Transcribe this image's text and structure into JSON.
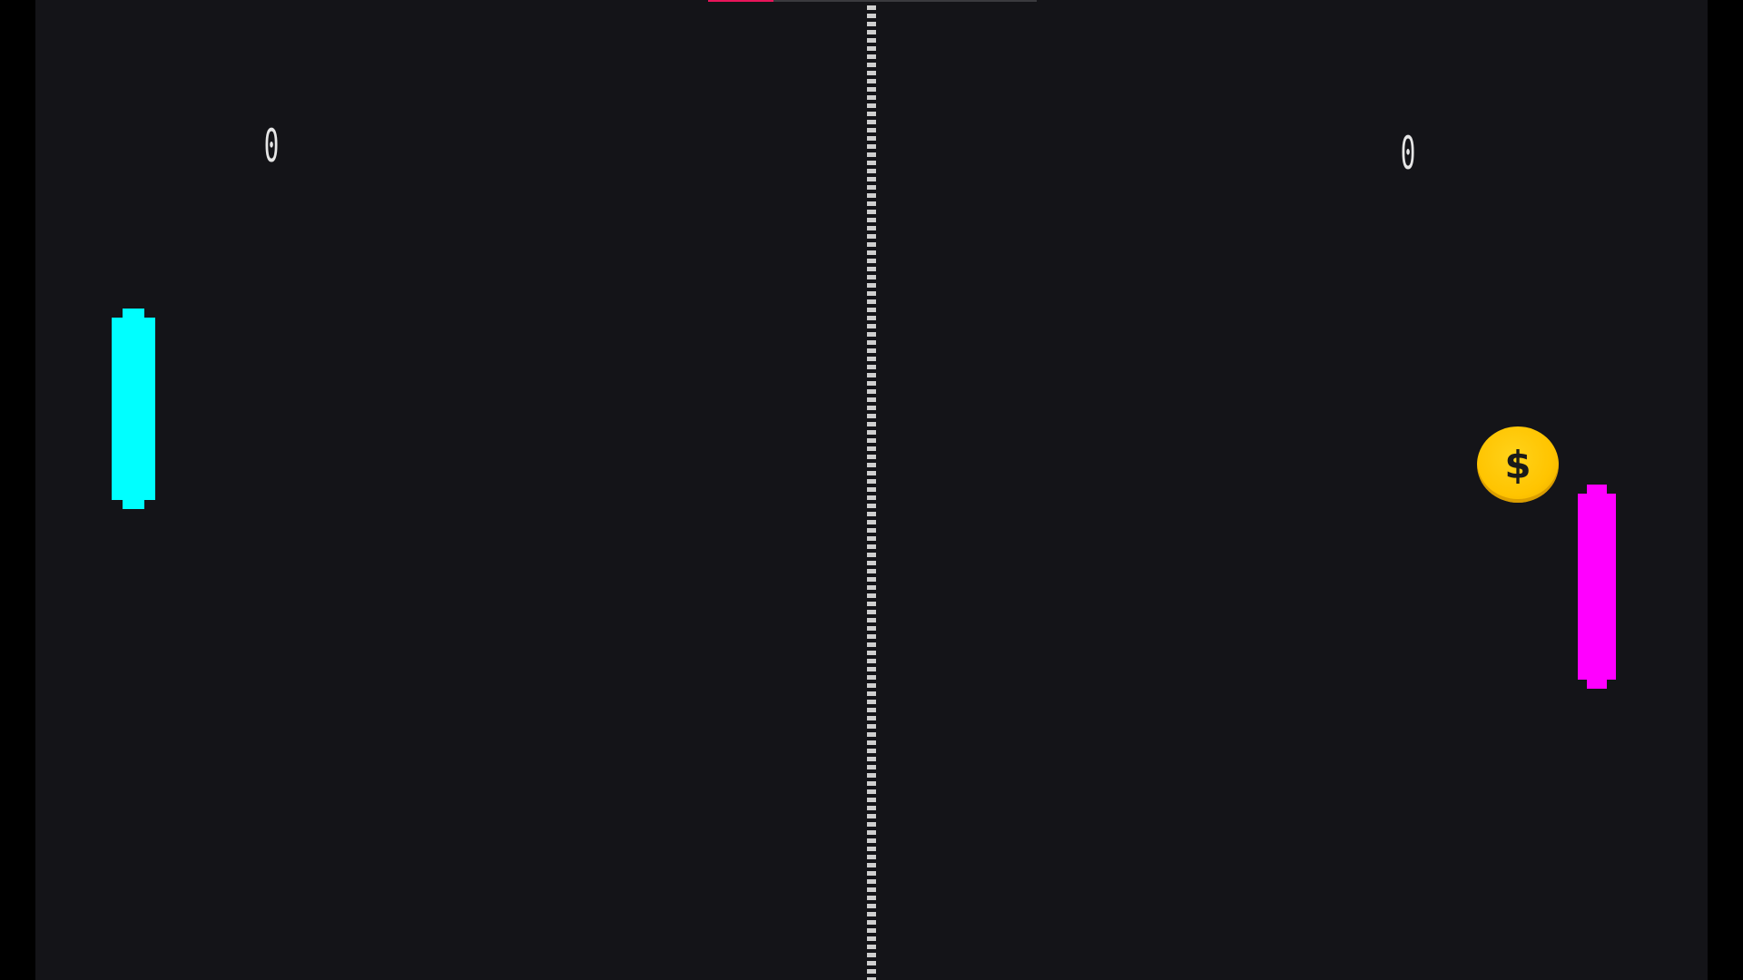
{
  "game": {
    "title": "",
    "colors": {
      "background": "#141418",
      "frame": "#000000",
      "net": "#cfcfcf",
      "score_text": "#e6e6e6",
      "player_left": "#00ffff",
      "player_right": "#ff00ff",
      "coin": "#ffc400",
      "progress_fill": "#e8155a",
      "progress_track": "#3a3a3e"
    },
    "top_progress": {
      "fraction": 0.2
    }
  },
  "scoreboard": {
    "left_score": "0",
    "right_score": "0"
  },
  "powerup": {
    "icon": "dollar-coin-icon",
    "symbol": "$"
  }
}
